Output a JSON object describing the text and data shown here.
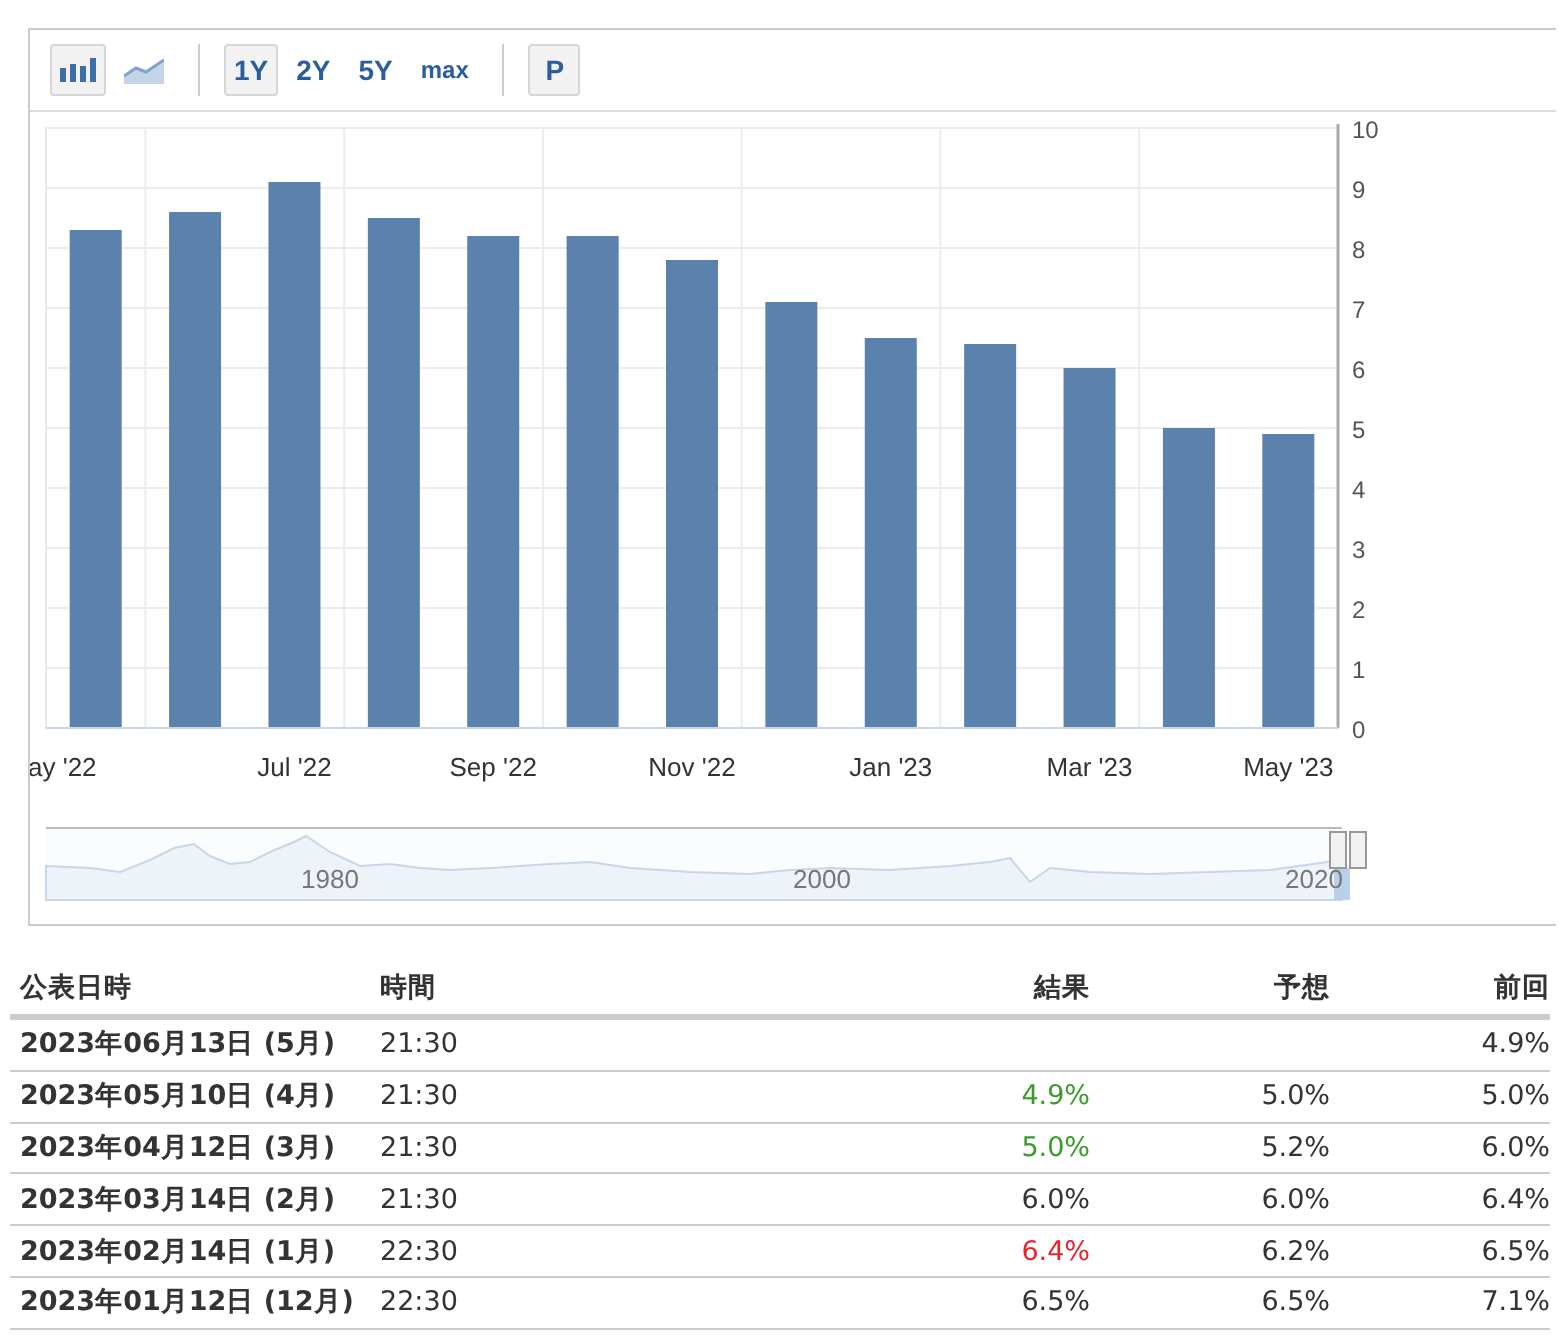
{
  "toolbar": {
    "chart_types": [
      {
        "kind": "bar",
        "selected": true
      },
      {
        "kind": "area",
        "selected": false
      }
    ],
    "ranges": [
      {
        "label": "1Y",
        "selected": true
      },
      {
        "label": "2Y",
        "selected": false
      },
      {
        "label": "5Y",
        "selected": false
      },
      {
        "label": "max",
        "selected": false
      }
    ],
    "extra_button": "P"
  },
  "chart": {
    "chart_data": {
      "type": "bar",
      "categories": [
        "ay '22",
        null,
        "Jul '22",
        null,
        "Sep '22",
        null,
        "Nov '22",
        null,
        "Jan '23",
        null,
        "Mar '23",
        null,
        "May '23"
      ],
      "series": [
        {
          "color": "#5b82ad",
          "values": [
            8.3,
            8.6,
            9.1,
            8.5,
            8.2,
            8.2,
            7.8,
            7.1,
            6.5,
            6.4,
            6.0,
            5.0,
            4.9
          ]
        }
      ],
      "grid": true,
      "ylim": [
        0,
        10
      ],
      "yticks": [
        0,
        1,
        2,
        3,
        4,
        5,
        6,
        7,
        8,
        9,
        10
      ]
    }
  },
  "navigator": {
    "labels": [
      "1980",
      "2000",
      "2020"
    ]
  },
  "table": {
    "columns": [
      "公表日時",
      "時間",
      "結果",
      "予想",
      "前回"
    ],
    "rows": [
      {
        "date": "2023年06月13日 (5月)",
        "time": "21:30",
        "actual": "",
        "forecast": "",
        "previous": "4.9%"
      },
      {
        "date": "2023年05月10日 (4月)",
        "time": "21:30",
        "actual": "4.9%",
        "color": "#3a9b2b",
        "forecast": "5.0%",
        "previous": "5.0%"
      },
      {
        "date": "2023年04月12日 (3月)",
        "time": "21:30",
        "actual": "5.0%",
        "color": "#3a9b2b",
        "forecast": "5.2%",
        "previous": "6.0%"
      },
      {
        "date": "2023年03月14日 (2月)",
        "time": "21:30",
        "actual": "6.0%",
        "color": "#333333",
        "forecast": "6.0%",
        "previous": "6.4%"
      },
      {
        "date": "2023年02月14日 (1月)",
        "time": "22:30",
        "actual": "6.4%",
        "color": "#e8242c",
        "forecast": "6.2%",
        "previous": "6.5%"
      },
      {
        "date": "2023年01月12日 (12月)",
        "time": "22:30",
        "actual": "6.5%",
        "color": "#333333",
        "forecast": "6.5%",
        "previous": "7.1%"
      }
    ]
  }
}
